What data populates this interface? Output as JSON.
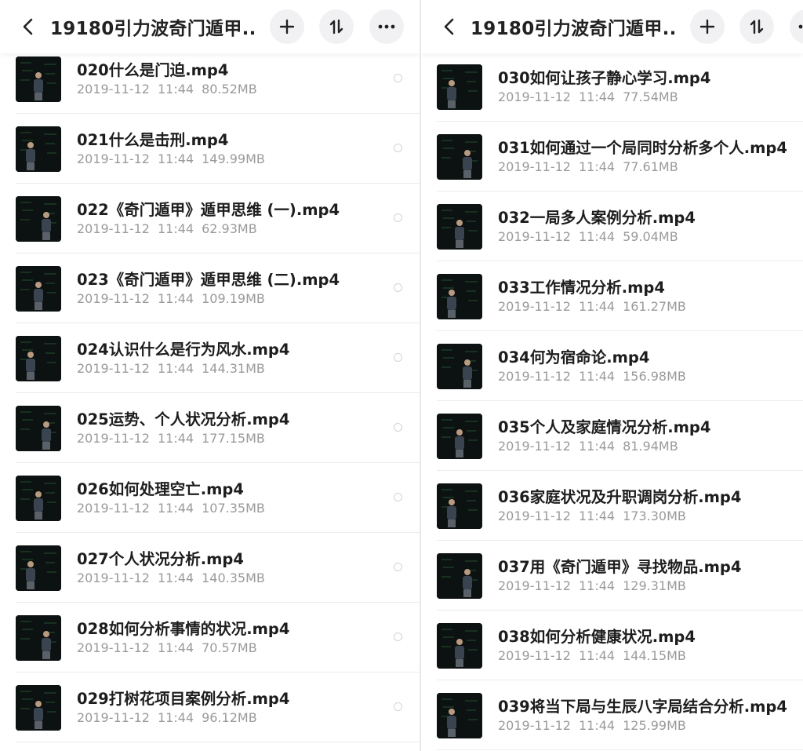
{
  "left_panel": {
    "title": "19180引力波奇门遁甲...",
    "items": [
      {
        "name": "020什么是门迫.mp4",
        "date": "2019-11-12",
        "time": "11:44",
        "size": "80.52MB"
      },
      {
        "name": "021什么是击刑.mp4",
        "date": "2019-11-12",
        "time": "11:44",
        "size": "149.99MB"
      },
      {
        "name": "022《奇门遁甲》遁甲思维 (一).mp4",
        "date": "2019-11-12",
        "time": "11:44",
        "size": "62.93MB"
      },
      {
        "name": "023《奇门遁甲》遁甲思维 (二).mp4",
        "date": "2019-11-12",
        "time": "11:44",
        "size": "109.19MB"
      },
      {
        "name": "024认识什么是行为风水.mp4",
        "date": "2019-11-12",
        "time": "11:44",
        "size": "144.31MB"
      },
      {
        "name": "025运势、个人状况分析.mp4",
        "date": "2019-11-12",
        "time": "11:44",
        "size": "177.15MB"
      },
      {
        "name": "026如何处理空亡.mp4",
        "date": "2019-11-12",
        "time": "11:44",
        "size": "107.35MB"
      },
      {
        "name": "027个人状况分析.mp4",
        "date": "2019-11-12",
        "time": "11:44",
        "size": "140.35MB"
      },
      {
        "name": "028如何分析事情的状况.mp4",
        "date": "2019-11-12",
        "time": "11:44",
        "size": "70.57MB"
      },
      {
        "name": "029打树花项目案例分析.mp4",
        "date": "2019-11-12",
        "time": "11:44",
        "size": "96.12MB"
      }
    ]
  },
  "right_panel": {
    "title": "19180引力波奇门遁甲...",
    "items": [
      {
        "name": "030如何让孩子静心学习.mp4",
        "date": "2019-11-12",
        "time": "11:44",
        "size": "77.54MB"
      },
      {
        "name": "031如何通过一个局同时分析多个人.mp4",
        "date": "2019-11-12",
        "time": "11:44",
        "size": "77.61MB"
      },
      {
        "name": "032一局多人案例分析.mp4",
        "date": "2019-11-12",
        "time": "11:44",
        "size": "59.04MB"
      },
      {
        "name": "033工作情况分析.mp4",
        "date": "2019-11-12",
        "time": "11:44",
        "size": "161.27MB"
      },
      {
        "name": "034何为宿命论.mp4",
        "date": "2019-11-12",
        "time": "11:44",
        "size": "156.98MB"
      },
      {
        "name": "035个人及家庭情况分析.mp4",
        "date": "2019-11-12",
        "time": "11:44",
        "size": "81.94MB"
      },
      {
        "name": "036家庭状况及升职调岗分析.mp4",
        "date": "2019-11-12",
        "time": "11:44",
        "size": "173.30MB"
      },
      {
        "name": "037用《奇门遁甲》寻找物品.mp4",
        "date": "2019-11-12",
        "time": "11:44",
        "size": "129.31MB"
      },
      {
        "name": "038如何分析健康状况.mp4",
        "date": "2019-11-12",
        "time": "11:44",
        "size": "144.15MB"
      },
      {
        "name": "039将当下局与生辰八字局结合分析.mp4",
        "date": "2019-11-12",
        "time": "11:44",
        "size": "125.99MB"
      }
    ]
  },
  "icons": {
    "back": "chevron-left-icon",
    "add": "plus-icon",
    "sort": "sort-icon",
    "more": "more-icon",
    "thumbnail": "video-thumbnail"
  },
  "colors": {
    "accent_bg": "#f1f1f3",
    "text_primary": "#1d1d1d",
    "text_secondary": "#9a9a9a"
  }
}
